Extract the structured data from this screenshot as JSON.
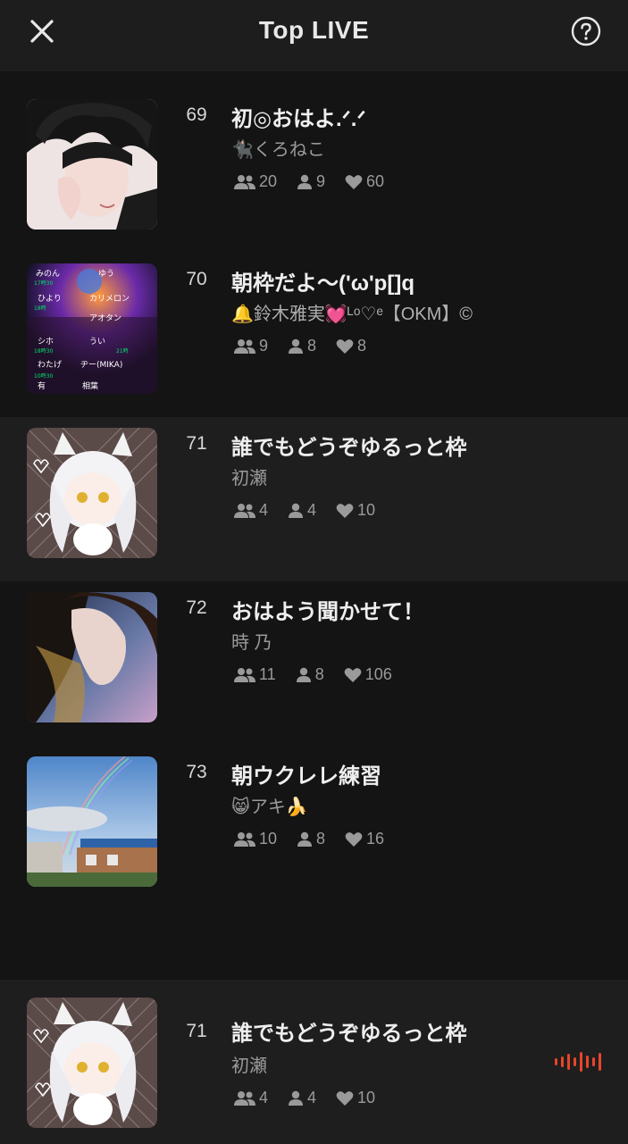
{
  "header": {
    "title": "Top LIVE",
    "close_icon": "close-icon",
    "help_icon": "help-icon"
  },
  "colors": {
    "background": "#141414",
    "row_alt": "#1e1e1e",
    "accent_live": "#e8452a"
  },
  "items": [
    {
      "rank": "69",
      "title": "初◎おはよ.ᐟ.ᐟ",
      "host": "🐈‍⬛くろねこ",
      "listeners": "20",
      "viewers": "9",
      "likes": "60",
      "thumb": "dark-haired-boy-illustration"
    },
    {
      "rank": "70",
      "title": "朝枠だよ〜('ω'p[]q",
      "host": "🔔鈴木雅実💓ᴸᵒ♡ᵉ【OKM】©",
      "listeners": "9",
      "viewers": "8",
      "likes": "8",
      "thumb": "colorful-name-collage"
    },
    {
      "rank": "71",
      "title": "誰でもどうぞゆるっと枠",
      "host": "初瀬",
      "listeners": "4",
      "viewers": "4",
      "likes": "10",
      "thumb": "white-hair-cat-girl"
    },
    {
      "rank": "72",
      "title": "おはよう聞かせて！",
      "host": "時 乃",
      "listeners": "11",
      "viewers": "8",
      "likes": "106",
      "thumb": "girl-profile-in-wind"
    },
    {
      "rank": "73",
      "title": "朝ウクレレ練習",
      "host": "😸アキ🍌",
      "listeners": "10",
      "viewers": "8",
      "likes": "16",
      "thumb": "rainbow-over-houses"
    },
    {
      "rank": "71",
      "title": "誰でもどうぞゆるっと枠",
      "host": "初瀬",
      "listeners": "4",
      "viewers": "4",
      "likes": "10",
      "thumb": "white-hair-cat-girl",
      "now_playing": true
    }
  ]
}
